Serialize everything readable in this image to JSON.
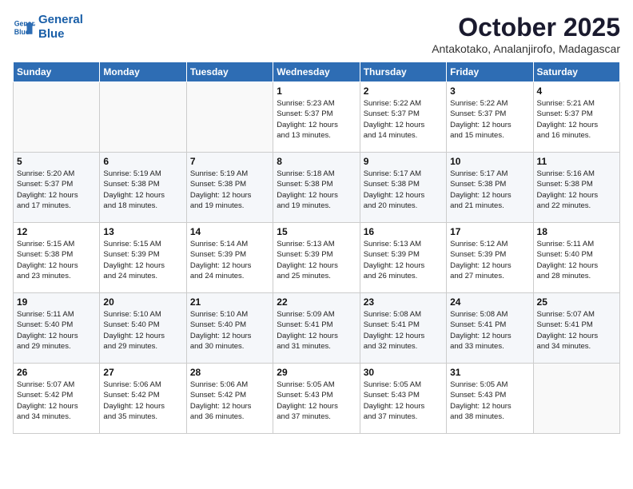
{
  "header": {
    "logo_line1": "General",
    "logo_line2": "Blue",
    "month": "October 2025",
    "location": "Antakotako, Analanjirofo, Madagascar"
  },
  "weekdays": [
    "Sunday",
    "Monday",
    "Tuesday",
    "Wednesday",
    "Thursday",
    "Friday",
    "Saturday"
  ],
  "weeks": [
    [
      {
        "day": "",
        "info": ""
      },
      {
        "day": "",
        "info": ""
      },
      {
        "day": "",
        "info": ""
      },
      {
        "day": "1",
        "info": "Sunrise: 5:23 AM\nSunset: 5:37 PM\nDaylight: 12 hours\nand 13 minutes."
      },
      {
        "day": "2",
        "info": "Sunrise: 5:22 AM\nSunset: 5:37 PM\nDaylight: 12 hours\nand 14 minutes."
      },
      {
        "day": "3",
        "info": "Sunrise: 5:22 AM\nSunset: 5:37 PM\nDaylight: 12 hours\nand 15 minutes."
      },
      {
        "day": "4",
        "info": "Sunrise: 5:21 AM\nSunset: 5:37 PM\nDaylight: 12 hours\nand 16 minutes."
      }
    ],
    [
      {
        "day": "5",
        "info": "Sunrise: 5:20 AM\nSunset: 5:37 PM\nDaylight: 12 hours\nand 17 minutes."
      },
      {
        "day": "6",
        "info": "Sunrise: 5:19 AM\nSunset: 5:38 PM\nDaylight: 12 hours\nand 18 minutes."
      },
      {
        "day": "7",
        "info": "Sunrise: 5:19 AM\nSunset: 5:38 PM\nDaylight: 12 hours\nand 19 minutes."
      },
      {
        "day": "8",
        "info": "Sunrise: 5:18 AM\nSunset: 5:38 PM\nDaylight: 12 hours\nand 19 minutes."
      },
      {
        "day": "9",
        "info": "Sunrise: 5:17 AM\nSunset: 5:38 PM\nDaylight: 12 hours\nand 20 minutes."
      },
      {
        "day": "10",
        "info": "Sunrise: 5:17 AM\nSunset: 5:38 PM\nDaylight: 12 hours\nand 21 minutes."
      },
      {
        "day": "11",
        "info": "Sunrise: 5:16 AM\nSunset: 5:38 PM\nDaylight: 12 hours\nand 22 minutes."
      }
    ],
    [
      {
        "day": "12",
        "info": "Sunrise: 5:15 AM\nSunset: 5:38 PM\nDaylight: 12 hours\nand 23 minutes."
      },
      {
        "day": "13",
        "info": "Sunrise: 5:15 AM\nSunset: 5:39 PM\nDaylight: 12 hours\nand 24 minutes."
      },
      {
        "day": "14",
        "info": "Sunrise: 5:14 AM\nSunset: 5:39 PM\nDaylight: 12 hours\nand 24 minutes."
      },
      {
        "day": "15",
        "info": "Sunrise: 5:13 AM\nSunset: 5:39 PM\nDaylight: 12 hours\nand 25 minutes."
      },
      {
        "day": "16",
        "info": "Sunrise: 5:13 AM\nSunset: 5:39 PM\nDaylight: 12 hours\nand 26 minutes."
      },
      {
        "day": "17",
        "info": "Sunrise: 5:12 AM\nSunset: 5:39 PM\nDaylight: 12 hours\nand 27 minutes."
      },
      {
        "day": "18",
        "info": "Sunrise: 5:11 AM\nSunset: 5:40 PM\nDaylight: 12 hours\nand 28 minutes."
      }
    ],
    [
      {
        "day": "19",
        "info": "Sunrise: 5:11 AM\nSunset: 5:40 PM\nDaylight: 12 hours\nand 29 minutes."
      },
      {
        "day": "20",
        "info": "Sunrise: 5:10 AM\nSunset: 5:40 PM\nDaylight: 12 hours\nand 29 minutes."
      },
      {
        "day": "21",
        "info": "Sunrise: 5:10 AM\nSunset: 5:40 PM\nDaylight: 12 hours\nand 30 minutes."
      },
      {
        "day": "22",
        "info": "Sunrise: 5:09 AM\nSunset: 5:41 PM\nDaylight: 12 hours\nand 31 minutes."
      },
      {
        "day": "23",
        "info": "Sunrise: 5:08 AM\nSunset: 5:41 PM\nDaylight: 12 hours\nand 32 minutes."
      },
      {
        "day": "24",
        "info": "Sunrise: 5:08 AM\nSunset: 5:41 PM\nDaylight: 12 hours\nand 33 minutes."
      },
      {
        "day": "25",
        "info": "Sunrise: 5:07 AM\nSunset: 5:41 PM\nDaylight: 12 hours\nand 34 minutes."
      }
    ],
    [
      {
        "day": "26",
        "info": "Sunrise: 5:07 AM\nSunset: 5:42 PM\nDaylight: 12 hours\nand 34 minutes."
      },
      {
        "day": "27",
        "info": "Sunrise: 5:06 AM\nSunset: 5:42 PM\nDaylight: 12 hours\nand 35 minutes."
      },
      {
        "day": "28",
        "info": "Sunrise: 5:06 AM\nSunset: 5:42 PM\nDaylight: 12 hours\nand 36 minutes."
      },
      {
        "day": "29",
        "info": "Sunrise: 5:05 AM\nSunset: 5:43 PM\nDaylight: 12 hours\nand 37 minutes."
      },
      {
        "day": "30",
        "info": "Sunrise: 5:05 AM\nSunset: 5:43 PM\nDaylight: 12 hours\nand 37 minutes."
      },
      {
        "day": "31",
        "info": "Sunrise: 5:05 AM\nSunset: 5:43 PM\nDaylight: 12 hours\nand 38 minutes."
      },
      {
        "day": "",
        "info": ""
      }
    ]
  ]
}
